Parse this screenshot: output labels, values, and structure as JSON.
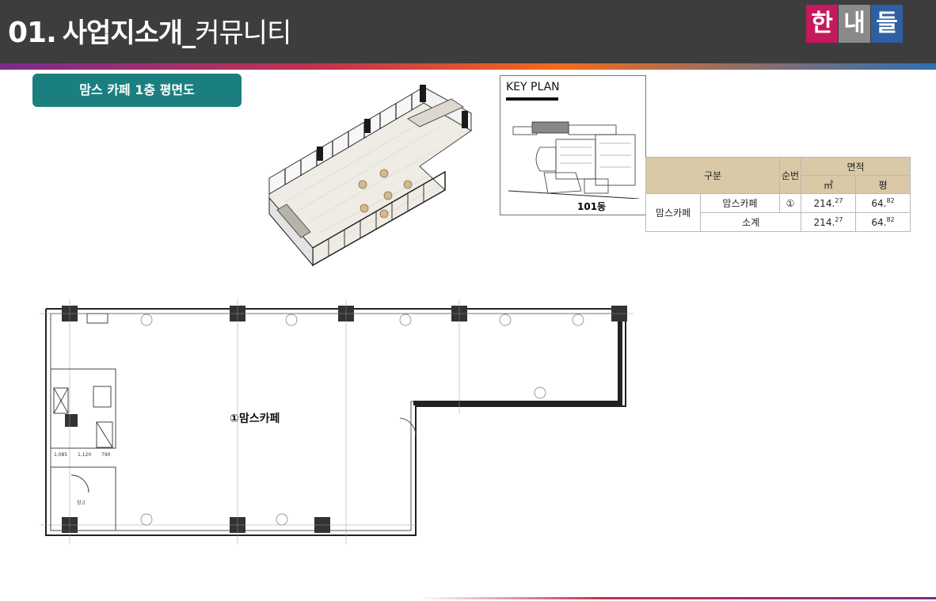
{
  "header": {
    "number": "01.",
    "title_bold": "사업지소개_",
    "title_regular": "커뮤니티"
  },
  "logo": {
    "chars": [
      "한",
      "내",
      "들"
    ],
    "colors": [
      "#c4195c",
      "#8a8a8a",
      "#2e5fa3"
    ]
  },
  "section_tag": "맘스 카페 1층 평면도",
  "key_plan": {
    "title": "KEY PLAN",
    "building": "101동"
  },
  "area_table": {
    "headers": {
      "category": "구분",
      "order": "순번",
      "area": "면적",
      "sqm": "㎡",
      "pyeong": "평"
    },
    "group": "맘스카페",
    "rows": [
      {
        "name": "맘스카페",
        "order": "①",
        "sqm_int": "214.",
        "sqm_dec": "27",
        "py_int": "64.",
        "py_dec": "82"
      },
      {
        "name": "소계",
        "order": "",
        "sqm_int": "214.",
        "sqm_dec": "27",
        "py_int": "64.",
        "py_dec": "82"
      }
    ]
  },
  "floor_plan": {
    "room_label": "①맘스카페",
    "storage_label": "창고",
    "dims": [
      "1,085",
      "1,120",
      "790"
    ]
  },
  "colors": {
    "header_bg": "#3d3d3d",
    "tag_bg": "#1b7f80",
    "table_header": "#d9c9a6"
  }
}
